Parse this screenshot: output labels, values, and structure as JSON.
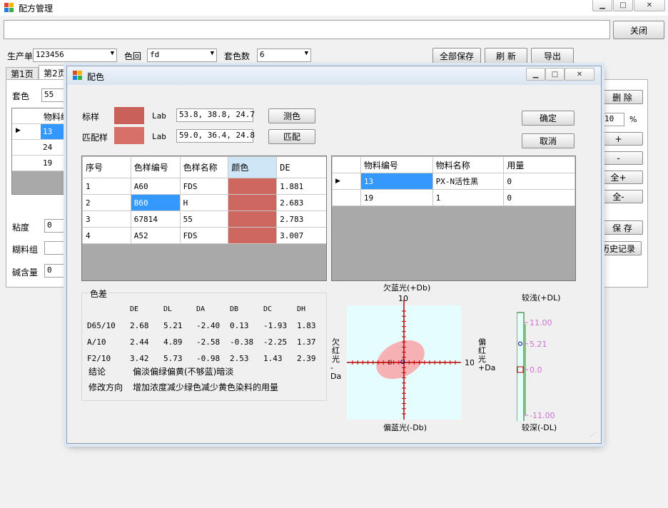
{
  "main": {
    "title": "配方管理",
    "close_label": "关闭",
    "production_label": "生产单",
    "production_value": "123456",
    "color_return_label": "色回",
    "color_return_value": "fd",
    "set_count_label": "套色数",
    "set_count_value": "6",
    "save_all_label": "全部保存",
    "refresh_label": "刷 新",
    "export_label": "导出",
    "tabs": [
      "第1页",
      "第2页"
    ],
    "set_color_label": "套色",
    "set_color_value": "55",
    "material_header": "物料编",
    "material_rows": [
      "13",
      "24",
      "19"
    ],
    "viscosity_label": "粘度",
    "viscosity_value": "0",
    "paste_label": "糊料组",
    "alkali_label": "碱含量",
    "alkali_value": "0",
    "delete_label": "删 除",
    "percent_value": "10",
    "percent_unit": "%",
    "plus_label": "+",
    "minus_label": "-",
    "all_plus_label": "全+",
    "all_minus_label": "全-",
    "save_label": "保 存",
    "history_label": "历史记录"
  },
  "dialog": {
    "title": "配色",
    "standard_label": "标样",
    "standard_lab_label": "Lab",
    "standard_lab_value": "53.8, 38.8, 24.7",
    "match_label": "匹配样",
    "match_lab_label": "Lab",
    "match_lab_value": "59.0, 36.4, 24.8",
    "measure_label": "测色",
    "match_button_label": "匹配",
    "ok_label": "确定",
    "cancel_label": "取消",
    "standard_color": "#c9605a",
    "match_color": "#d8706a",
    "match_table": {
      "headers": [
        "序号",
        "色样编号",
        "色样名称",
        "颜色",
        "DE"
      ],
      "rows": [
        {
          "no": "1",
          "code": "A60",
          "name": "FDS",
          "color": "#cd6760",
          "de": "1.881"
        },
        {
          "no": "2",
          "code": "B60",
          "name": "H",
          "color": "#cd6760",
          "de": "2.683"
        },
        {
          "no": "3",
          "code": "67814",
          "name": "55",
          "color": "#cd6760",
          "de": "2.783"
        },
        {
          "no": "4",
          "code": "A52",
          "name": "FDS",
          "color": "#cd6760",
          "de": "3.007"
        }
      ]
    },
    "material_table": {
      "headers": [
        "物料编号",
        "物料名称",
        "用量"
      ],
      "rows": [
        {
          "code": "13",
          "name": "PX-N活性黑",
          "amount": "0"
        },
        {
          "code": "19",
          "name": "1",
          "amount": "0"
        }
      ]
    },
    "color_diff": {
      "title": "色差",
      "headers": [
        "DE",
        "DL",
        "DA",
        "DB",
        "DC",
        "DH"
      ],
      "rows": [
        {
          "illuminant": "D65/10",
          "values": [
            "2.68",
            "5.21",
            "-2.40",
            "0.13",
            "-1.93",
            "1.83"
          ]
        },
        {
          "illuminant": "A/10",
          "values": [
            "2.44",
            "4.89",
            "-2.58",
            "-0.38",
            "-2.25",
            "1.37"
          ]
        },
        {
          "illuminant": "F2/10",
          "values": [
            "3.42",
            "5.73",
            "-0.98",
            "2.53",
            "1.43",
            "2.39"
          ]
        }
      ],
      "conclusion_label": "结论",
      "conclusion_value": "偏淡偏绿偏黄(不够蓝)暗淡",
      "direction_label": "修改方向",
      "direction_value": "增加浓度减少绿色减少黄色染料的用量"
    },
    "ab_chart": {
      "top_label": "欠蓝光(+Db)",
      "bottom_label": "偏蓝光(-Db)",
      "left_label": [
        "欠",
        "红",
        "光",
        "-Da"
      ],
      "right_label": [
        "偏",
        "红",
        "光",
        "+Da"
      ],
      "top_tick": "10",
      "right_tick": "10",
      "origin_label": "0"
    },
    "l_chart": {
      "top_label": "较浅(+DL)",
      "bottom_label": "较深(-DL)",
      "ticks": [
        "11.00",
        "5.21",
        "0.0",
        "-11.00"
      ]
    }
  },
  "chart_data": [
    {
      "type": "scatter",
      "title": "",
      "xlabel": "偏红光 +Da / 欠红光 -Da",
      "ylabel": "欠蓝光(+Db) / 偏蓝光(-Db)",
      "xlim": [
        -10,
        10
      ],
      "ylim": [
        -10,
        10
      ],
      "points": [
        {
          "x": -2.4,
          "y": 0.13
        }
      ],
      "tolerance_ellipse": {
        "center": [
          0,
          0
        ],
        "color": "#f6a8ac"
      }
    },
    {
      "type": "scatter",
      "title": "",
      "ylabel": "DL",
      "ylim": [
        -11,
        11
      ],
      "points": [
        {
          "y": 5.21
        }
      ]
    }
  ]
}
